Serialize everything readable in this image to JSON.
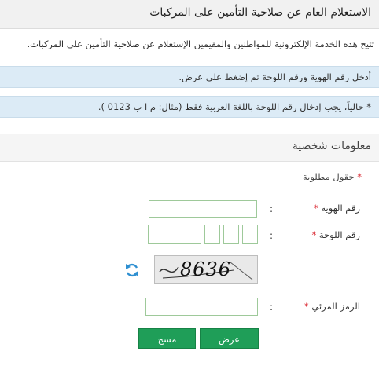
{
  "header": {
    "title": "الاستعلام العام عن صلاحية التأمين على المركبات"
  },
  "intro": "تتيح هذه الخدمة الإلكترونية للمواطنين والمقيمين الإستعلام عن صلاحية التأمين على المركبات.",
  "notices": [
    "أدخل رقم الهوية ورقم اللوحة ثم إضغط على عرض.",
    "* حالياً، يجب إدخال رقم اللوحة باللغة العربية فقط (مثال: م ا ب 0123 )."
  ],
  "section": {
    "title": "معلومات شخصية",
    "required_note": "حقول مطلوبة",
    "required_star": "*"
  },
  "form": {
    "id_label": "رقم الهوية",
    "plate_label": "رقم اللوحة",
    "captcha_label": "الرمز المرئي",
    "star": "*",
    "colon": ":",
    "id_value": "",
    "captcha_value": "",
    "captcha_image_text": "8636"
  },
  "buttons": {
    "show": "عرض",
    "clear": "مسح"
  },
  "colors": {
    "accent": "#1f9e58",
    "info_bg": "#dcebf6",
    "required": "#d9232d",
    "field_border": "#9ec99a"
  },
  "icons": {
    "refresh": "refresh-icon"
  }
}
